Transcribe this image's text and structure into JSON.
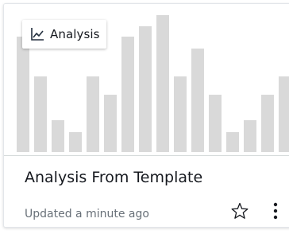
{
  "card": {
    "type_label": "Analysis",
    "type_icon": "line-chart-icon",
    "title": "Analysis From Template",
    "updated": "Updated a minute ago",
    "favorite_icon": "star-outline-icon",
    "more_icon": "vertical-ellipsis-icon",
    "accent_color": "#232f3e",
    "preview_bar_color": "#d9d9d9"
  },
  "chart_data": {
    "type": "bar",
    "values": [
      145,
      95,
      40,
      25,
      95,
      72,
      145,
      158,
      172,
      95,
      130,
      72,
      25,
      40,
      72,
      95
    ]
  }
}
